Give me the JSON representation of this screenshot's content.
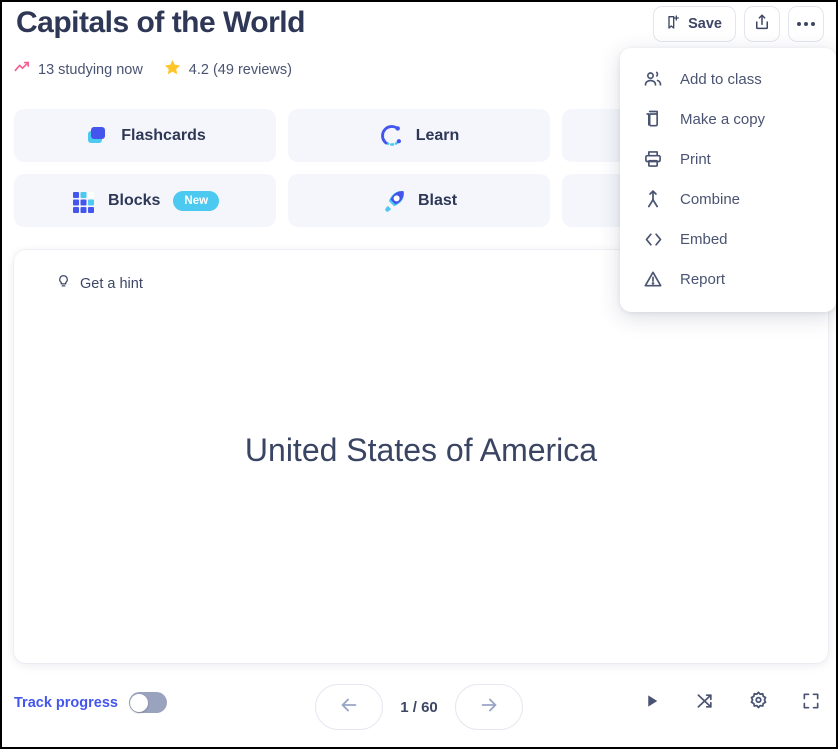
{
  "header": {
    "title": "Capitals of the World",
    "studying": "13 studying now",
    "rating": "4.2 (49 reviews)",
    "trending_icon": "trending-up-icon",
    "star_icon": "star-icon"
  },
  "toolbar": {
    "save_label": "Save",
    "save_icon": "bookmark-plus-icon",
    "share_icon": "share-icon",
    "more_icon": "more-horizontal-icon"
  },
  "menu": {
    "items": [
      {
        "label": "Add to class",
        "icon": "people-icon"
      },
      {
        "label": "Make a copy",
        "icon": "copy-icon"
      },
      {
        "label": "Print",
        "icon": "printer-icon"
      },
      {
        "label": "Combine",
        "icon": "combine-icon"
      },
      {
        "label": "Embed",
        "icon": "code-brackets-icon"
      },
      {
        "label": "Report",
        "icon": "warning-triangle-icon"
      }
    ]
  },
  "modes": [
    {
      "label": "Flashcards",
      "icon": "flashcards-icon",
      "badge": ""
    },
    {
      "label": "Learn",
      "icon": "learn-icon",
      "badge": ""
    },
    {
      "label": "",
      "icon": "",
      "badge": ""
    },
    {
      "label": "Blocks",
      "icon": "blocks-icon",
      "badge": "New"
    },
    {
      "label": "Blast",
      "icon": "blast-rocket-icon",
      "badge": ""
    },
    {
      "label": "",
      "icon": "",
      "badge": ""
    }
  ],
  "card": {
    "hint_label": "Get a hint",
    "hint_icon": "lightbulb-icon",
    "term": "United States of America"
  },
  "bottom": {
    "track_label": "Track progress",
    "track_enabled": false,
    "prev_icon": "arrow-left-icon",
    "next_icon": "arrow-right-icon",
    "counter": "1 / 60",
    "play_icon": "play-icon",
    "shuffle_icon": "shuffle-icon",
    "settings_icon": "gear-icon",
    "fullscreen_icon": "fullscreen-icon"
  },
  "colors": {
    "indigo": "#4455ee",
    "cyan": "#4cc9f0",
    "ink": "#2e3856",
    "slate": "#4a5472",
    "star": "#ffc629",
    "pink": "#f4608f",
    "panel": "#f4f6fb"
  }
}
